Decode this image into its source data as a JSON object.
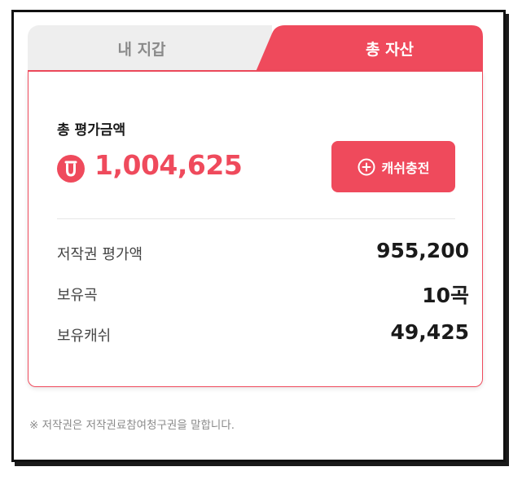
{
  "tabs": {
    "wallet": "내 지갑",
    "total_assets": "총 자산"
  },
  "summary": {
    "label": "총 평가금액",
    "value": "1,004,625",
    "charge_button": "캐쉬충전"
  },
  "details": [
    {
      "label": "저작권 평가액",
      "value": "955,200"
    },
    {
      "label": "보유곡",
      "value": "10곡"
    },
    {
      "label": "보유캐쉬",
      "value": "49,425"
    }
  ],
  "footnote": "※ 저작권은 저작권료참여청구권을 말합니다.",
  "colors": {
    "accent": "#ef4a5c",
    "inactive_tab": "#eeeeee"
  },
  "icons": {
    "coin": "coin-icon",
    "plus_circle": "plus-circle-icon"
  }
}
